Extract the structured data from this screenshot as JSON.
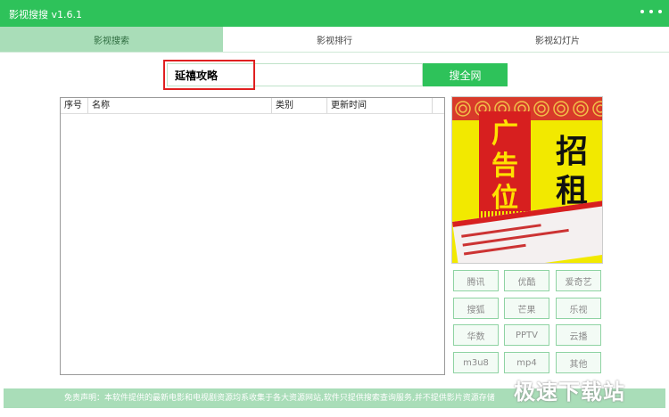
{
  "app": {
    "title": "影视搜搜 v1.6.1"
  },
  "icons": {
    "menu": "more-dots-icon"
  },
  "colors": {
    "accent": "#2ec25a",
    "tab_active": "#a9ddb8",
    "highlight": "#e02020"
  },
  "tabs": [
    {
      "label": "影视搜索",
      "active": true
    },
    {
      "label": "影视排行",
      "active": false
    },
    {
      "label": "影视幻灯片",
      "active": false
    }
  ],
  "search": {
    "value": "延禧攻略",
    "button_label": "搜全网"
  },
  "results": {
    "columns": [
      "序号",
      "名称",
      "类别",
      "更新时间",
      ""
    ],
    "rows": []
  },
  "ad": {
    "left_text": [
      "广",
      "告",
      "位"
    ],
    "right_text": [
      "招",
      "租"
    ]
  },
  "sources": [
    [
      "腾讯",
      "优酷",
      "爱奇艺"
    ],
    [
      "搜狐",
      "芒果",
      "乐视"
    ],
    [
      "华数",
      "PPTV",
      "云播"
    ],
    [
      "m3u8",
      "mp4",
      "其他"
    ]
  ],
  "footer": {
    "text": "免责声明：本软件提供的最新电影和电视剧资源均系收集于各大资源网站,软件只提供搜索查询服务,并不提供影片资源存储"
  },
  "watermark": "极速下载站"
}
